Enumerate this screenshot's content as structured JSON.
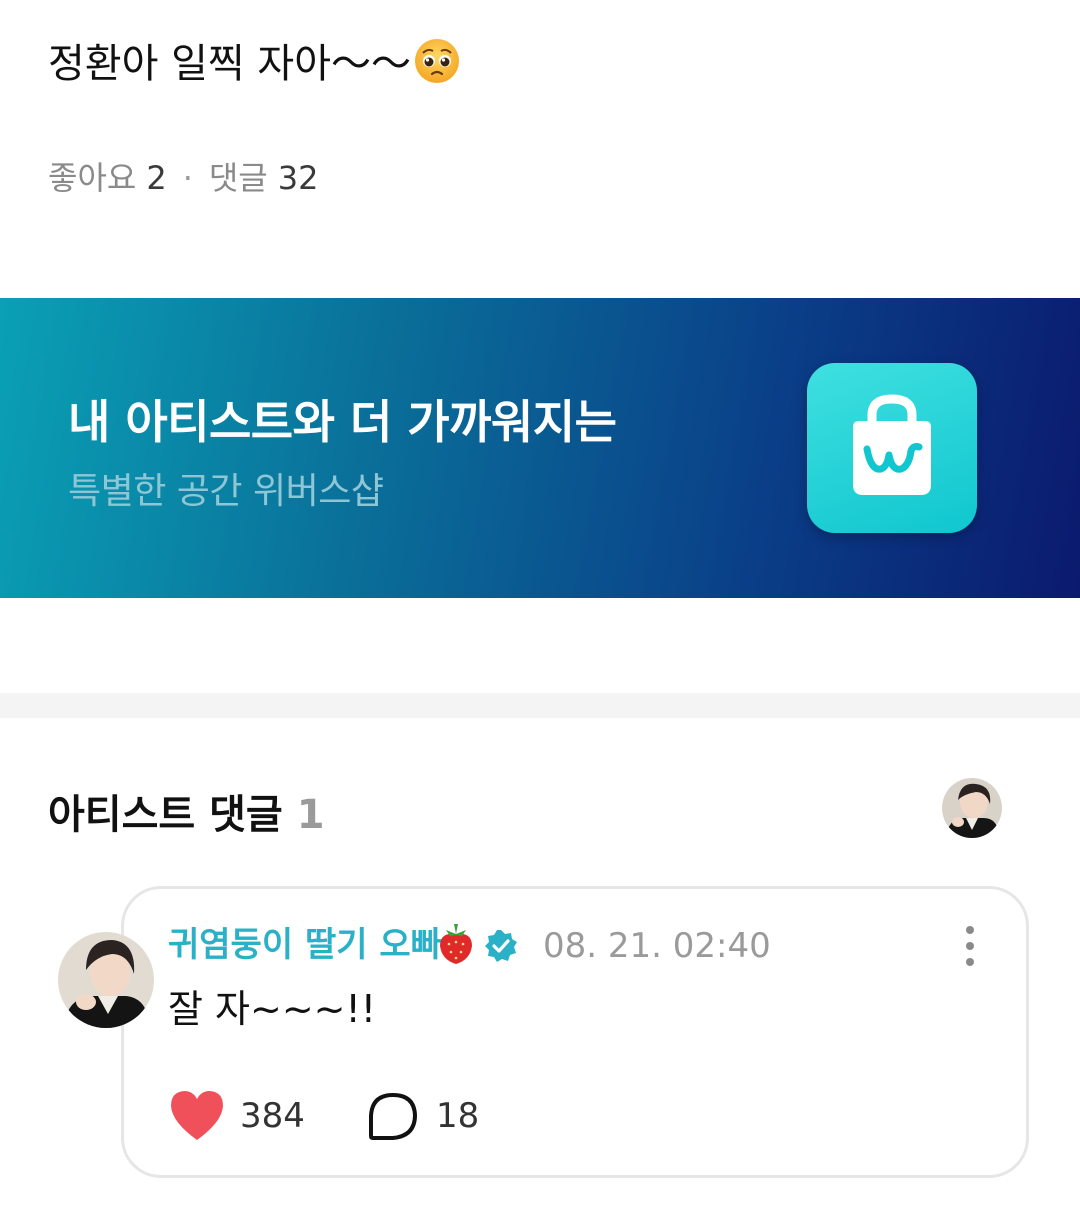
{
  "post": {
    "text": "정환아 일찍 자아〜〜",
    "emoji_icon": "pleading-face-emoji"
  },
  "stats": {
    "likes_label": "좋아요",
    "likes_count": "2",
    "separator": "·",
    "comments_label": "댓글",
    "comments_count": "32"
  },
  "banner": {
    "title": "내 아티스트와 더 가까워지는",
    "subtitle": "특별한 공간 위버스샵",
    "icon": "weverse-shop-bag-icon",
    "colors": {
      "start": "#0aa0b5",
      "end": "#0b1a6e",
      "icon_bg": "#10c6cf"
    }
  },
  "artist_comments": {
    "title": "아티스트 댓글",
    "count": "1"
  },
  "comment": {
    "author": "귀염둥이 딸기 오빠",
    "author_color": "#2ab1c8",
    "author_emoji": "strawberry-emoji",
    "verified_icon": "verified-badge-icon",
    "timestamp": "08. 21. 02:40",
    "text": "잘 자~~~!!",
    "like_count": "384",
    "reply_count": "18",
    "like_color": "#f0505a"
  }
}
